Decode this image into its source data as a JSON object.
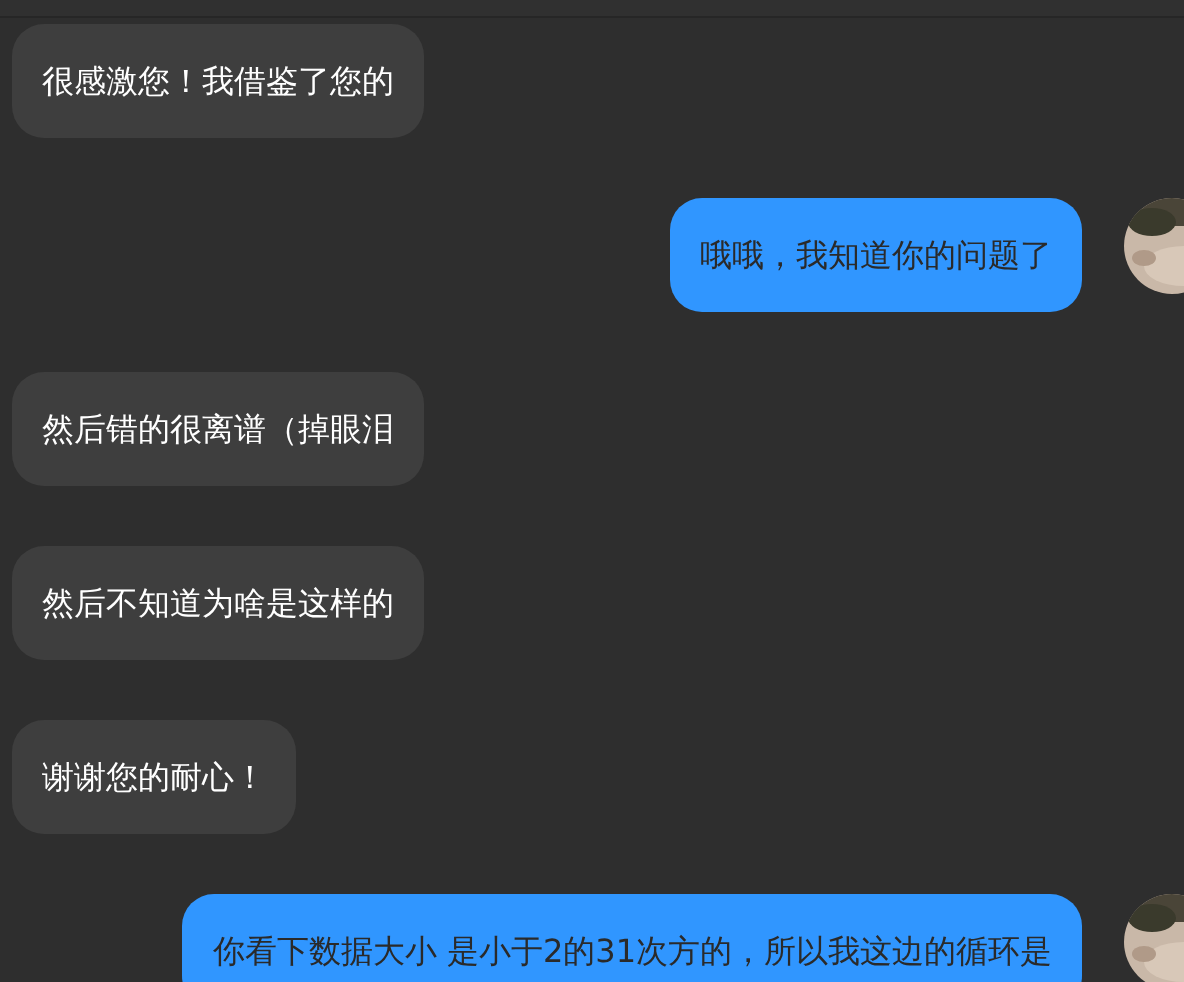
{
  "messages": [
    {
      "kind": "received",
      "text": "很感激您！我借鉴了您的"
    },
    {
      "kind": "sent",
      "text": "哦哦，我知道你的问题了"
    },
    {
      "kind": "received",
      "text": "然后错的很离谱（掉眼泪"
    },
    {
      "kind": "received",
      "text": "然后不知道为啥是这样的"
    },
    {
      "kind": "received",
      "text": "谢谢您的耐心！"
    },
    {
      "kind": "sent",
      "text": "你看下数据大小 是小于2的31次方的，所以我这边的循环是"
    }
  ]
}
